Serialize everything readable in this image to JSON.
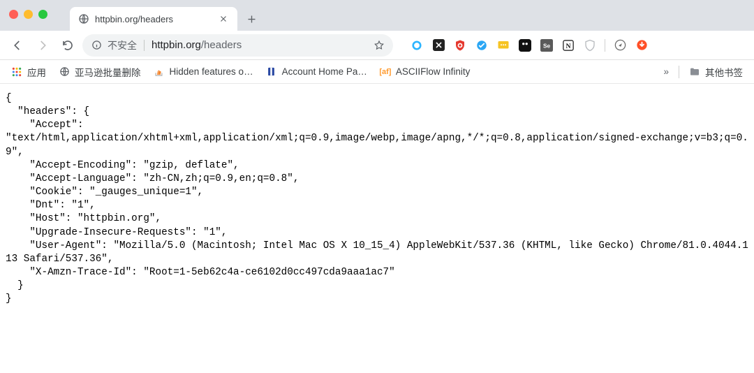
{
  "window": {
    "tab_title": "httpbin.org/headers"
  },
  "toolbar": {
    "insecure_label": "不安全",
    "url_host": "httpbin.org",
    "url_path": "/headers"
  },
  "bookmarks": {
    "apps_label": "应用",
    "items": [
      {
        "label": "亚马逊批量删除"
      },
      {
        "label": "Hidden features o…"
      },
      {
        "label": "Account Home Pa…"
      },
      {
        "label": "ASCIIFlow Infinity"
      }
    ],
    "overflow": "»",
    "other_label": "其他书签"
  },
  "extensions": [
    "ring-blue-icon",
    "x-icon",
    "ublock-icon",
    "blue-badge-icon",
    "yellow-msg-icon",
    "pocket-icon",
    "se-icon",
    "notion-icon",
    "shield-icon",
    "compass-icon",
    "down-orange-icon"
  ],
  "body_json": {
    "headers": {
      "Accept": "text/html,application/xhtml+xml,application/xml;q=0.9,image/webp,image/apng,*/*;q=0.8,application/signed-exchange;v=b3;q=0.9",
      "Accept-Encoding": "gzip, deflate",
      "Accept-Language": "zh-CN,zh;q=0.9,en;q=0.8",
      "Cookie": "_gauges_unique=1",
      "Dnt": "1",
      "Host": "httpbin.org",
      "Upgrade-Insecure-Requests": "1",
      "User-Agent": "Mozilla/5.0 (Macintosh; Intel Mac OS X 10_15_4) AppleWebKit/537.36 (KHTML, like Gecko) Chrome/81.0.4044.113 Safari/537.36",
      "X-Amzn-Trace-Id": "Root=1-5eb62c4a-ce6102d0cc497cda9aaa1ac7"
    }
  }
}
